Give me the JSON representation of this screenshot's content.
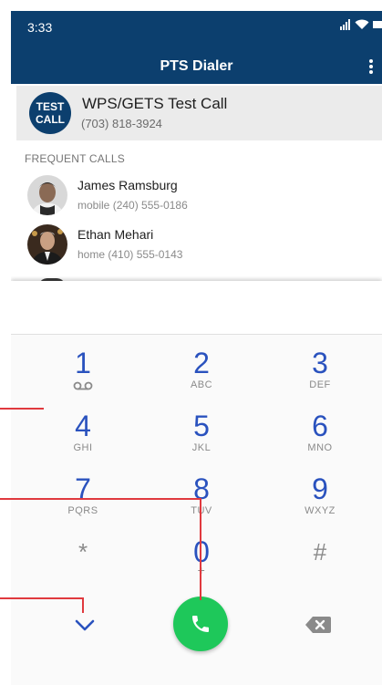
{
  "status_bar": {
    "time": "3:33",
    "icons": [
      "signal-icon",
      "wifi-icon",
      "battery-icon"
    ]
  },
  "app_bar": {
    "title": "PTS Dialer",
    "menu_icon": "more-vert-icon"
  },
  "test_call": {
    "badge_line1": "TEST",
    "badge_line2": "CALL",
    "name": "WPS/GETS Test Call",
    "number": "(703) 818-3924"
  },
  "frequent": {
    "header": "FREQUENT CALLS",
    "contacts": [
      {
        "name": "James Ramsburg",
        "type": "mobile",
        "number": "(240) 555-0186"
      },
      {
        "name": "Ethan Mehari",
        "type": "home",
        "number": "(410) 555-0143"
      }
    ]
  },
  "dialpad": {
    "input_value": "",
    "keys": [
      {
        "digit": "1",
        "letters": ""
      },
      {
        "digit": "2",
        "letters": "ABC"
      },
      {
        "digit": "3",
        "letters": "DEF"
      },
      {
        "digit": "4",
        "letters": "GHI"
      },
      {
        "digit": "5",
        "letters": "JKL"
      },
      {
        "digit": "6",
        "letters": "MNO"
      },
      {
        "digit": "7",
        "letters": "PQRS"
      },
      {
        "digit": "8",
        "letters": "TUV"
      },
      {
        "digit": "9",
        "letters": "WXYZ"
      },
      {
        "digit": "*",
        "letters": ""
      },
      {
        "digit": "0",
        "letters": "+"
      },
      {
        "digit": "#",
        "letters": ""
      }
    ],
    "voicemail_icon": "voicemail-icon",
    "collapse_icon": "chevron-down-icon",
    "call_icon": "phone-icon",
    "backspace_icon": "backspace-icon"
  },
  "colors": {
    "primary": "#0c3f6e",
    "accent": "#2a52be",
    "call": "#1ec85a",
    "overlay": "#e0393e"
  }
}
